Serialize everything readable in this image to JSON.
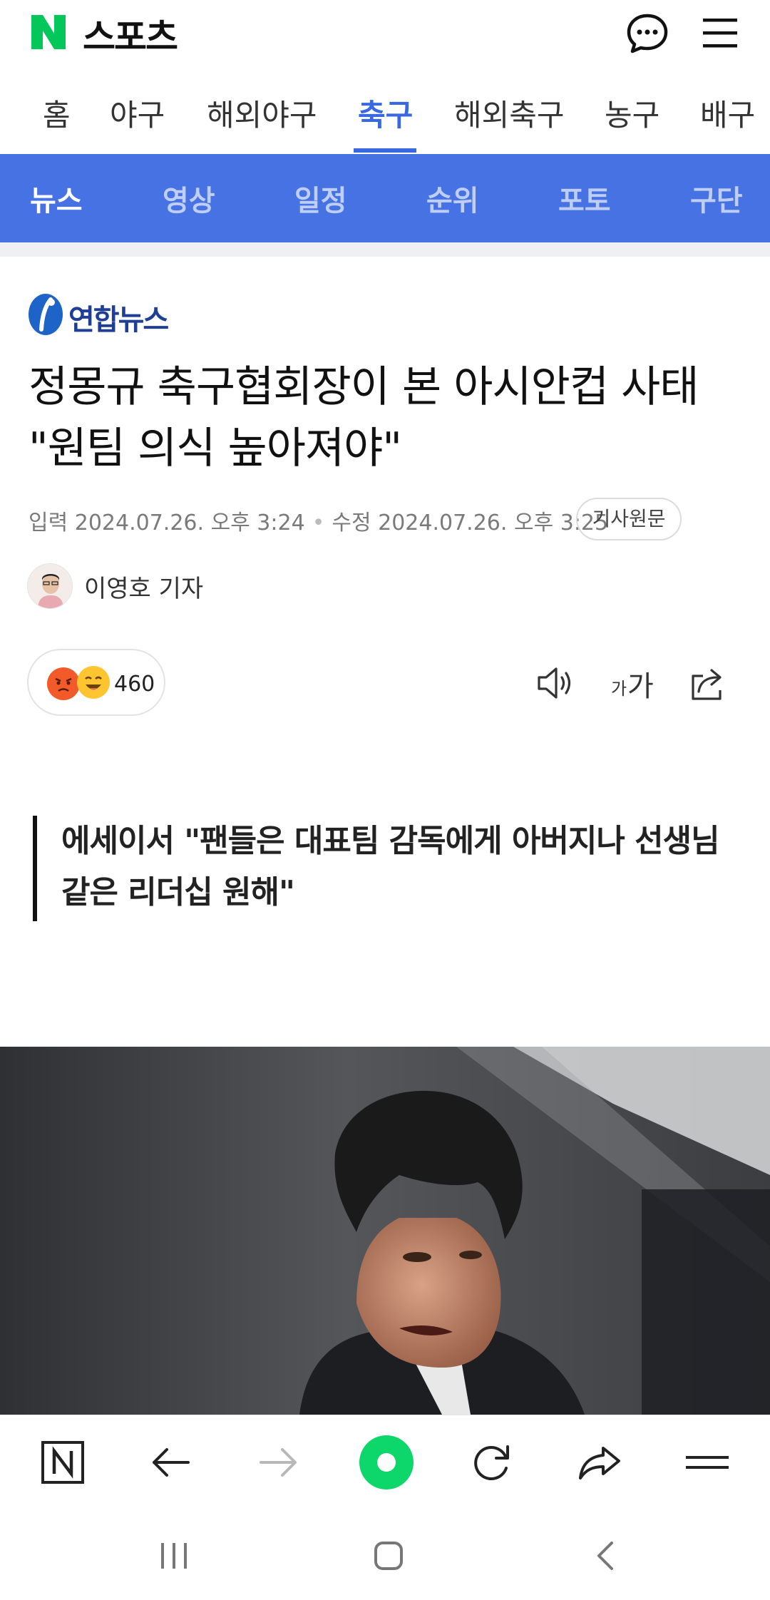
{
  "header": {
    "logo_icon": "naver-n-logo-icon",
    "brand": "스포츠",
    "chat_icon": "chat-bubble-icon",
    "menu_icon": "hamburger-menu-icon"
  },
  "category_tabs": [
    {
      "label": "홈"
    },
    {
      "label": "야구"
    },
    {
      "label": "해외야구"
    },
    {
      "label": "축구",
      "active": true
    },
    {
      "label": "해외축구"
    },
    {
      "label": "농구"
    },
    {
      "label": "배구"
    }
  ],
  "sub_nav": [
    {
      "label": "뉴스",
      "active": true
    },
    {
      "label": "영상"
    },
    {
      "label": "일정"
    },
    {
      "label": "순위"
    },
    {
      "label": "포토"
    },
    {
      "label": "구단"
    }
  ],
  "article": {
    "press": "연합뉴스",
    "headline": "정몽규 축구협회장이 본 아시안컵 사태 \"원팀 의식 높아져야\"",
    "published": "입력 2024.07.26. 오후 3:24",
    "modified": "수정 2024.07.26. 오후 3:25",
    "original_link": "기사원문",
    "reporter": "이영호 기자",
    "reaction_count": "460",
    "font_small": "가",
    "font_big": "가",
    "subtitle": "에세이서 \"팬들은 대표팀 감독에게 아버지나 선생님 같은 리더십 원해\""
  },
  "colors": {
    "accent": "#3a68e3",
    "subnav_bg": "#4672e4",
    "naver_green": "#03c75a"
  },
  "browser_bar": {
    "icons": [
      "naver-home-icon",
      "back-arrow-icon",
      "forward-arrow-icon",
      "green-dot-icon",
      "refresh-icon",
      "share-icon",
      "menu-icon"
    ]
  },
  "system_nav": {
    "icons": [
      "recent-apps-icon",
      "home-icon",
      "back-icon"
    ]
  }
}
